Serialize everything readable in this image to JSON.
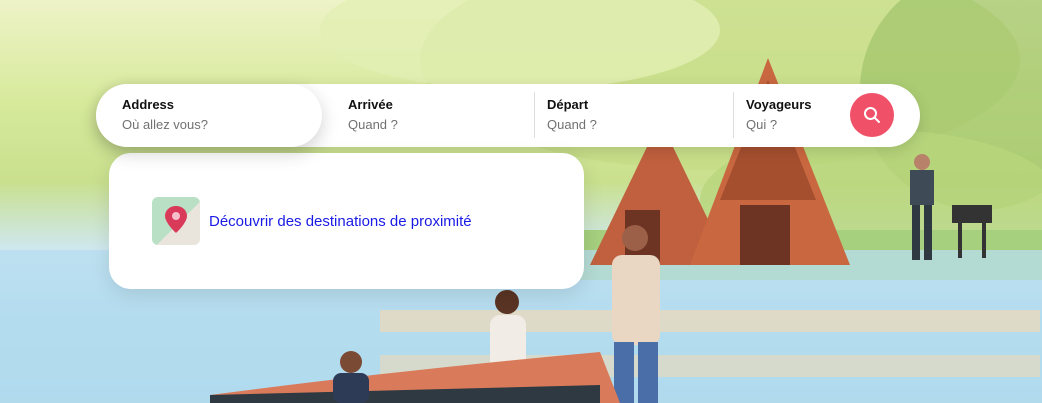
{
  "search": {
    "address": {
      "label": "Address",
      "placeholder": "Où allez vous?"
    },
    "arrivee": {
      "label": "Arrivée",
      "placeholder": "Quand ?"
    },
    "depart": {
      "label": "Départ",
      "placeholder": "Quand ?"
    },
    "voyageurs": {
      "label": "Voyageurs",
      "placeholder": "Qui ?"
    },
    "button_icon": "search-icon",
    "accent_color": "#f05068"
  },
  "dropdown": {
    "suggestion": {
      "icon": "map-pin-icon",
      "label": "Découvrir des destinations de proximité"
    }
  }
}
